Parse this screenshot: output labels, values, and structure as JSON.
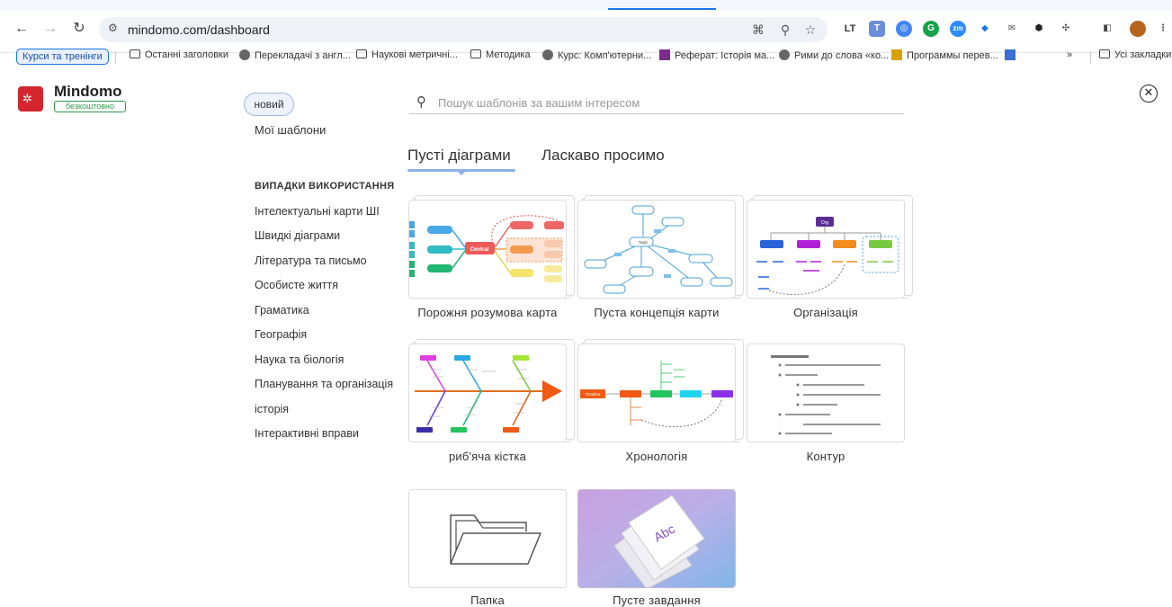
{
  "browser": {
    "url": "mindomo.com/dashboard",
    "bookmarks": [
      {
        "label": "Курси та тренінги"
      },
      {
        "label": "Останні заголовки"
      },
      {
        "label": "Перекладачі з англ..."
      },
      {
        "label": "Наукові метричні..."
      },
      {
        "label": "Методика"
      },
      {
        "label": "Курс: Комп'ютерни..."
      },
      {
        "label": "Реферат: Історія ма..."
      },
      {
        "label": "Рими до слова «ко..."
      },
      {
        "label": "Программы перев..."
      }
    ],
    "more_label": "»",
    "all_bookmarks": "Усі закладки"
  },
  "app": {
    "brand": "Mindomo",
    "badge": "безкоштовно",
    "new_button": "новий",
    "my_templates": "Мої шаблони",
    "categories_heading": "ВИПАДКИ ВИКОРИСТАННЯ",
    "categories": [
      "Інтелектуальні карти ШІ",
      "Швидкі діаграми",
      "Література та письмо",
      "Особисте життя",
      "Граматика",
      "Географія",
      "Наука та біологія",
      "Планування та організація",
      "історія",
      "Інтерактивні вправи"
    ],
    "search_placeholder": "Пошук шаблонів за вашим інтересом",
    "tabs": [
      "Пусті діаграми",
      "Ласкаво просимо"
    ],
    "cards": [
      {
        "label": "Порожня розумова карта"
      },
      {
        "label": "Пуста концепція карти"
      },
      {
        "label": "Організація"
      },
      {
        "label": "риб'яча кістка"
      },
      {
        "label": "Хронологія"
      },
      {
        "label": "Контур"
      },
      {
        "label": "Папка"
      },
      {
        "label": "Пусте завдання"
      }
    ],
    "thumb_text": {
      "central": "Central",
      "level1": "Level 1",
      "level2": "Level 2",
      "topic": "Topic",
      "org": "Org",
      "main_topic": "Main topic",
      "timeline": "Timeline",
      "abc": "Abc"
    }
  }
}
